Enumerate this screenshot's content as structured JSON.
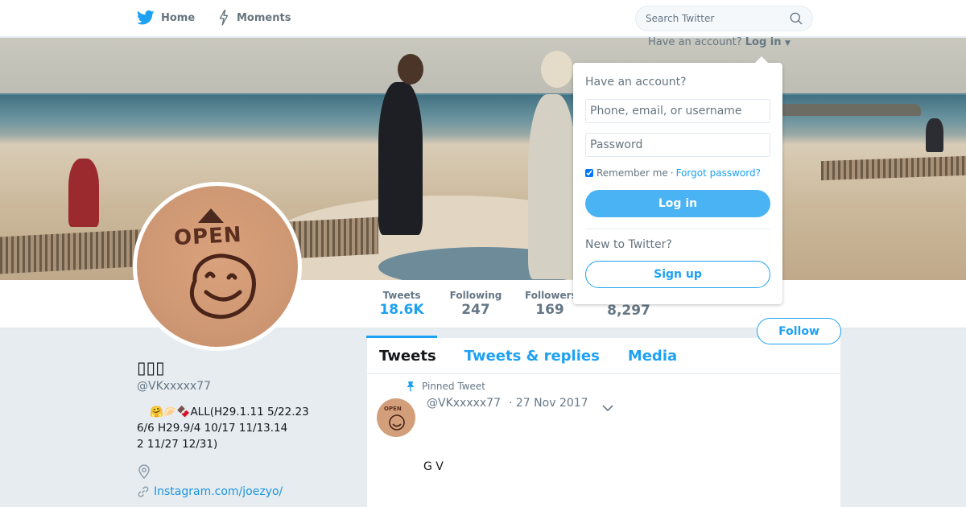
{
  "nav": {
    "home_label": "Home",
    "moments_label": "Moments",
    "search_placeholder": "Search Twitter"
  },
  "login_prompt": {
    "text": "Have an account?",
    "login_link": "Log in"
  },
  "login_dropdown": {
    "title": "Have an account?",
    "username_placeholder": "Phone, email, or username",
    "password_placeholder": "Password",
    "remember_label": "Remember me",
    "separator": "·",
    "forgot_label": "Forgot password?",
    "login_button": "Log in",
    "new_label": "New to Twitter?",
    "signup_button": "Sign up"
  },
  "avatar": {
    "text": "OPEN"
  },
  "stats": {
    "tweets_label": "Tweets",
    "tweets_value": "18.6K",
    "following_label": "Following",
    "following_value": "247",
    "followers_label": "Followers",
    "followers_value": "169",
    "likes_value": "8,297"
  },
  "follow_button": "Follow",
  "profile": {
    "name": "▯▯▯",
    "handle": "@VKxxxxx77",
    "bio_emoji": "🤗🥟🍫",
    "bio_line1": "ALL(H29.1.11 5/22.23",
    "bio_line2": "6/6 H29.9/4 10/17 11/13.14",
    "bio_line3": "2 11/27 12/31)",
    "link": "Instagram.com/joezyo/"
  },
  "timeline": {
    "tabs": [
      "Tweets",
      "Tweets & replies",
      "Media"
    ],
    "pinned_label": "Pinned Tweet",
    "tweet": {
      "avatar_text": "OPEN",
      "handle": "@VKxxxxx77",
      "date": "· 27 Nov 2017",
      "text": "G V"
    }
  },
  "colors": {
    "brand_blue": "#1da1f2",
    "login_button_blue": "#4ab3f4",
    "background": "#e6ecf0"
  },
  "icons": {
    "home": "twitter-bird-icon",
    "moments": "lightning-bolt-icon",
    "search": "search-icon",
    "location": "location-pin-icon",
    "link": "link-icon",
    "pin": "pin-icon",
    "caret": "chevron-down-icon"
  }
}
